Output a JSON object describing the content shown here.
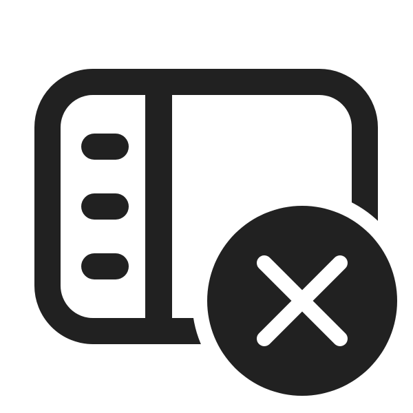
{
  "icon": {
    "name": "sidebar-dismiss-icon",
    "parts": [
      "window-frame-icon",
      "sidebar-panel-icon",
      "sidebar-menu-lines-icon",
      "dismiss-circle-icon",
      "close-x-icon"
    ],
    "colors": {
      "foreground": "#212121",
      "background": "#ffffff"
    }
  }
}
